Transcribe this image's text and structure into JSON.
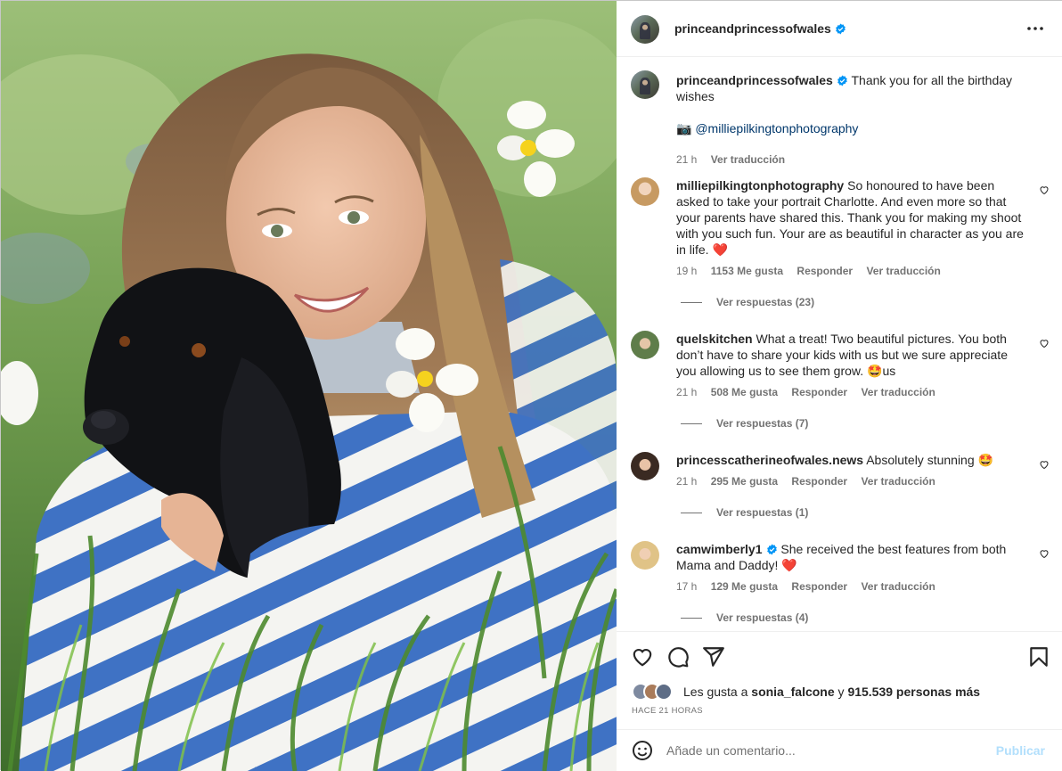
{
  "post": {
    "username": "princeandprincessofwales",
    "caption": "Thank you for all the birthday wishes",
    "photo_credit": "@milliepilkingtonphotography",
    "caption_time": "21 h",
    "translate": "Ver traducción"
  },
  "comments": [
    {
      "username": "milliepilkingtonphotography",
      "text": "So honoured to have been asked to take your portrait Charlotte. And even more so that your parents have shared this. Thank you for making my shoot with you such fun. Your are as beautiful in character as you are in life.",
      "emoji": "❤️",
      "time": "19 h",
      "likes": "1153 Me gusta",
      "reply": "Responder",
      "translate": "Ver traducción",
      "replies": "Ver respuestas (23)"
    },
    {
      "username": "quelskitchen",
      "text": "What a treat! Two beautiful pictures. You both don’t have to share your kids with us but we sure appreciate you allowing us to see them grow.",
      "emoji": "🤩",
      "text_after": "us",
      "time": "21 h",
      "likes": "508 Me gusta",
      "reply": "Responder",
      "translate": "Ver traducción",
      "replies": "Ver respuestas (7)"
    },
    {
      "username": "princesscatherineofwales.news",
      "text": "Absolutely stunning",
      "emoji": "🤩",
      "time": "21 h",
      "likes": "295 Me gusta",
      "reply": "Responder",
      "translate": "Ver traducción",
      "replies": "Ver respuestas (1)"
    },
    {
      "username": "camwimberly1",
      "text": "She received the best features from both Mama and Daddy!",
      "emoji": "❤️",
      "time": "17 h",
      "likes": "129 Me gusta",
      "reply": "Responder",
      "translate": "Ver traducción",
      "replies": "Ver respuestas (4)"
    }
  ],
  "likes": {
    "prefix": "Les gusta a",
    "user": "sonia_falcone",
    "connector": "y",
    "count": "915.539 personas más"
  },
  "time_ago": "HACE 21 HORAS",
  "comment_box": {
    "placeholder": "Añade un comentario...",
    "publish": "Publicar"
  },
  "colors": {
    "verified": "#0095f6",
    "link": "#00376b",
    "secondary_text": "#737373",
    "publish_disabled": "#b2dffc",
    "heart_red": "#ed4956"
  }
}
